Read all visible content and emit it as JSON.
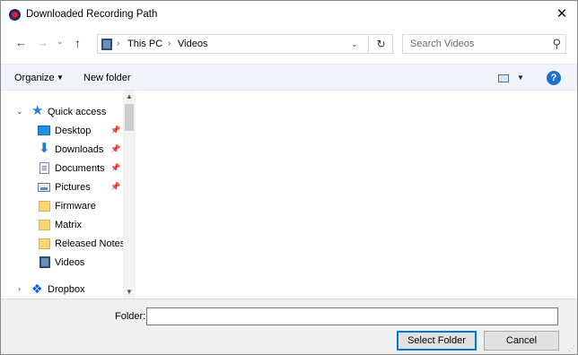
{
  "window": {
    "title": "Downloaded Recording Path",
    "close_glyph": "✕"
  },
  "navigation": {
    "back_glyph": "←",
    "forward_glyph": "→",
    "recent_glyph": "⌄",
    "up_glyph": "↑",
    "address": {
      "icon": "videos-folder-icon",
      "segments": [
        "This PC",
        "Videos"
      ],
      "separator": "›",
      "dropdown_glyph": "⌄"
    },
    "refresh_glyph": "↻",
    "search": {
      "placeholder": "Search Videos",
      "icon_glyph": "⚲"
    }
  },
  "toolbar": {
    "organize_label": "Organize",
    "organize_caret": "▼",
    "new_folder_label": "New folder",
    "view_caret": "▼",
    "help_glyph": "?"
  },
  "nav_pane": {
    "quick_access_label": "Quick access",
    "items": [
      {
        "label": "Desktop",
        "icon": "desktop-icon",
        "pinned": true
      },
      {
        "label": "Downloads",
        "icon": "downloads-icon",
        "pinned": true
      },
      {
        "label": "Documents",
        "icon": "documents-icon",
        "pinned": true
      },
      {
        "label": "Pictures",
        "icon": "pictures-icon",
        "pinned": true
      },
      {
        "label": "Firmware",
        "icon": "folder-icon",
        "pinned": false
      },
      {
        "label": "Matrix",
        "icon": "folder-icon",
        "pinned": false
      },
      {
        "label": "Released Notes",
        "icon": "folder-icon",
        "pinned": false
      },
      {
        "label": "Videos",
        "icon": "videos-icon",
        "pinned": false
      }
    ],
    "dropbox_label": "Dropbox",
    "pin_glyph": "📌",
    "expanded_glyph": "⌄",
    "collapsed_glyph": "›",
    "scroll_up_glyph": "▲",
    "scroll_down_glyph": "▼"
  },
  "footer": {
    "folder_label": "Folder:",
    "folder_value": "",
    "select_button": "Select Folder",
    "cancel_button": "Cancel"
  },
  "colors": {
    "accent": "#0078d7",
    "toolbar_bg": "#f0f3f9",
    "footer_bg": "#f0f0f0",
    "help": "#1f6fd1"
  }
}
